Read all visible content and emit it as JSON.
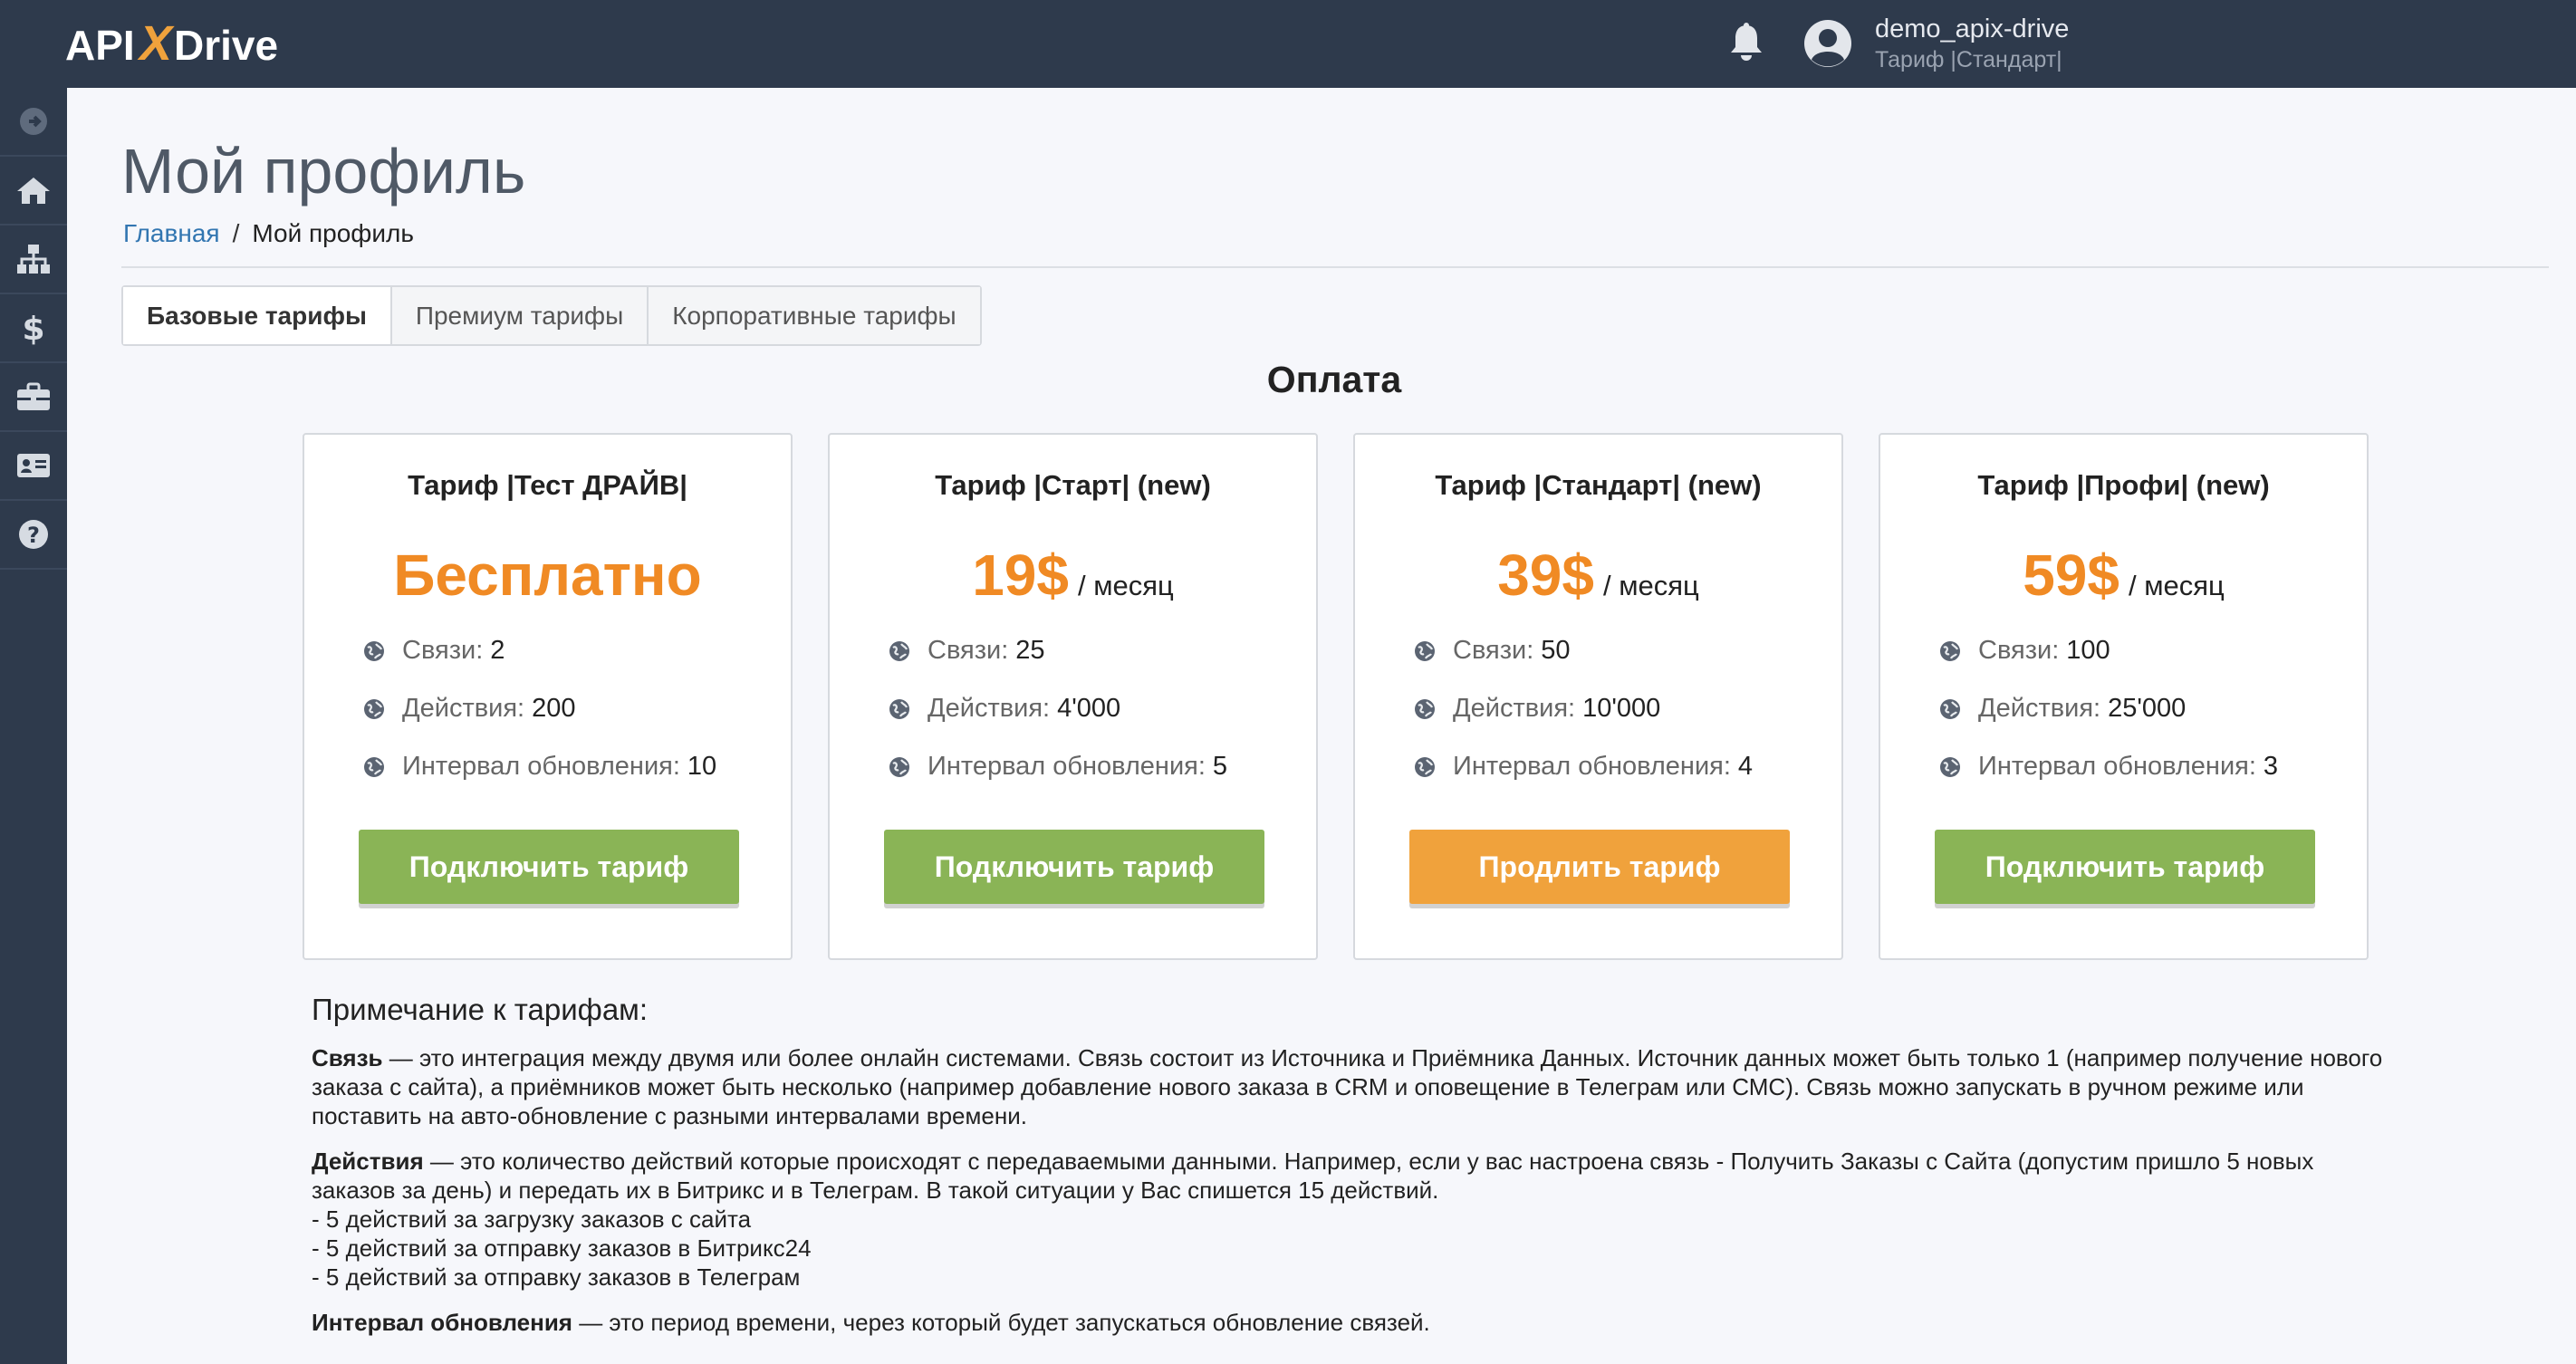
{
  "brand": {
    "logo_prefix": "API",
    "logo_x": "X",
    "logo_suffix": "Drive",
    "accent": "#f0a23c",
    "dark": "#2e3a4c"
  },
  "header": {
    "username": "demo_apix-drive",
    "plan": "Тариф |Стандарт|",
    "bell_icon": "bell-icon",
    "avatar_icon": "user-circle-icon"
  },
  "sidebar": {
    "items": [
      {
        "icon": "arrow-right-circle-icon"
      },
      {
        "icon": "home-icon"
      },
      {
        "icon": "sitemap-icon"
      },
      {
        "icon": "dollar-icon"
      },
      {
        "icon": "briefcase-icon"
      },
      {
        "icon": "id-card-icon"
      },
      {
        "icon": "question-circle-icon"
      }
    ]
  },
  "page": {
    "title": "Мой профиль",
    "breadcrumb": {
      "home": "Главная",
      "separator": "/",
      "current": "Мой профиль"
    }
  },
  "tabs": [
    {
      "label": "Базовые тарифы",
      "active": true
    },
    {
      "label": "Премиум тарифы",
      "active": false
    },
    {
      "label": "Корпоративные тарифы",
      "active": false
    }
  ],
  "section_title": "Оплата",
  "plans": [
    {
      "title": "Тариф |Тест ДРАЙВ|",
      "price": "Бесплатно",
      "unit": "",
      "features": [
        {
          "label": "Связи:",
          "value": "2"
        },
        {
          "label": "Действия:",
          "value": "200"
        },
        {
          "label": "Интервал обновления:",
          "value": "10"
        }
      ],
      "button": "Подключить тариф",
      "button_color": "#8ab456"
    },
    {
      "title": "Тариф |Старт| (new)",
      "price": "19$",
      "unit": "/ месяц",
      "features": [
        {
          "label": "Связи:",
          "value": "25"
        },
        {
          "label": "Действия:",
          "value": "4'000"
        },
        {
          "label": "Интервал обновления:",
          "value": "5"
        }
      ],
      "button": "Подключить тариф",
      "button_color": "#8ab456"
    },
    {
      "title": "Тариф |Стандарт| (new)",
      "price": "39$",
      "unit": "/ месяц",
      "features": [
        {
          "label": "Связи:",
          "value": "50"
        },
        {
          "label": "Действия:",
          "value": "10'000"
        },
        {
          "label": "Интервал обновления:",
          "value": "4"
        }
      ],
      "button": "Продлить тариф",
      "button_color": "#f0a23c"
    },
    {
      "title": "Тариф |Профи| (new)",
      "price": "59$",
      "unit": "/ месяц",
      "features": [
        {
          "label": "Связи:",
          "value": "100"
        },
        {
          "label": "Действия:",
          "value": "25'000"
        },
        {
          "label": "Интервал обновления:",
          "value": "3"
        }
      ],
      "button": "Подключить тариф",
      "button_color": "#8ab456"
    }
  ],
  "notes": {
    "title": "Примечание к тарифам:",
    "link_term": "Связь",
    "link_text": " — это интеграция между двумя или более онлайн системами. Связь состоит из Источника и Приёмника Данных. Источник данных может быть только 1 (например получение нового заказа с сайта), а приёмников может быть несколько (например добавление нового заказа в CRM и оповещение в Телеграм или СМС). Связь можно запускать в ручном режиме или поставить на авто-обновление с разными интервалами времени.",
    "actions_term": "Действия",
    "actions_text": " — это количество действий которые происходят с передаваемыми данными. Например, если у вас настроена связь - Получить Заказы с Сайта (допустим пришло 5 новых заказов за день) и передать их в Битрикс и в Телеграм. В такой ситуации у Вас спишется 15 действий.",
    "actions_lines": [
      "- 5 действий за загрузку заказов с сайта",
      "- 5 действий за отправку заказов в Битрикс24",
      "- 5 действий за отправку заказов в Телеграм"
    ],
    "interval_term": "Интервал обновления",
    "interval_text": " — это период времени, через который будет запускаться обновление связей."
  }
}
